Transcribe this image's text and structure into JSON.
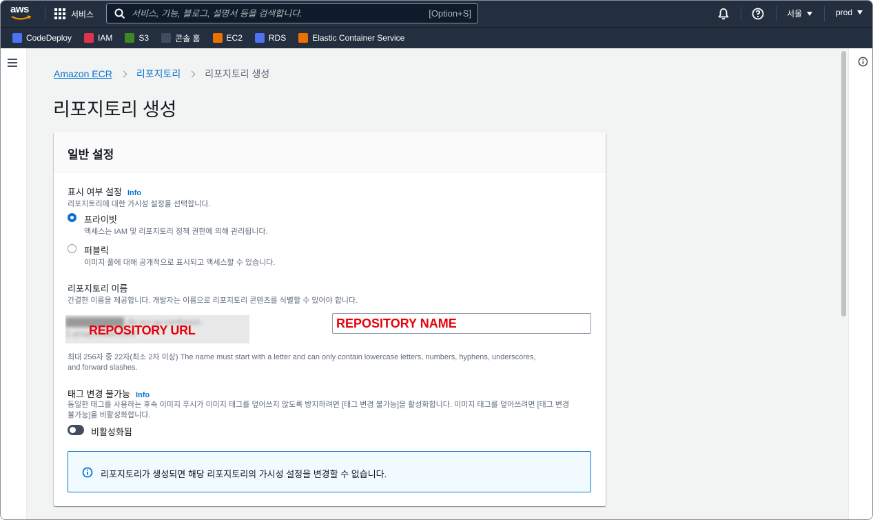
{
  "topnav": {
    "logo_text": "aws",
    "services_label": "서비스",
    "search_placeholder": "서비스, 기능, 블로그, 설명서 등을 검색합니다.",
    "search_shortcut": "[Option+S]",
    "region_label": "서울",
    "account_label": "prod"
  },
  "favorites": [
    {
      "label": "CodeDeploy",
      "color": "#4d72f3"
    },
    {
      "label": "IAM",
      "color": "#dd344c"
    },
    {
      "label": "S3",
      "color": "#3f8624"
    },
    {
      "label": "콘솔 홈",
      "color": "#414d5c"
    },
    {
      "label": "EC2",
      "color": "#ed7100"
    },
    {
      "label": "RDS",
      "color": "#4d72f3"
    },
    {
      "label": "Elastic Container Service",
      "color": "#ed7100"
    }
  ],
  "breadcrumb": {
    "root": "Amazon ECR",
    "parent": "리포지토리",
    "current": "리포지토리 생성"
  },
  "page_title": "리포지토리 생성",
  "general_settings": {
    "title": "일반 설정",
    "visibility": {
      "label": "표시 여부 설정",
      "info": "Info",
      "description": "리포지토리에 대한 가시성 설정을 선택합니다.",
      "options": [
        {
          "label": "프라이빗",
          "description": "액세스는 IAM 및 리포지토리 정책 권한에 의해 관리됩니다.",
          "selected": true
        },
        {
          "label": "퍼블릭",
          "description": "이미지 풀에 대해 공개적으로 표시되고 액세스할 수 있습니다.",
          "selected": false
        }
      ]
    },
    "repo_name": {
      "label": "리포지토리 이름",
      "description": "간결한 이름을 제공합니다. 개발자는 이름으로 리포지토리 콘텐츠를 식별할 수 있어야 합니다.",
      "url_prefix_blurred": "██████████.dkr.ecr.ap-northeast-2.amazonaws.com/",
      "url_annotation": "REPOSITORY URL",
      "name_annotation": "REPOSITORY NAME",
      "constraint_line1": "최대 256자 중 22자(최소 2자 이상) The name must start with a letter and can only contain lowercase letters, numbers, hyphens, underscores,",
      "constraint_line2": "and forward slashes."
    },
    "tag_immutability": {
      "label": "태그 변경 불가능",
      "info": "Info",
      "description_line1": "동일한 태그를 사용하는 후속 이미지 푸시가 이미지 태그를 덮어쓰지 않도록 방지하려면 [태그 변경 불가능]을 활성화합니다. 이미지 태그를 덮어쓰려면 [태그 변경",
      "description_line2": "불가능]을 비활성화합니다.",
      "toggle_label": "비활성화됨",
      "enabled": false
    },
    "alert_text": "리포지토리가 생성되면 해당 리포지토리의 가시성 설정을 변경할 수 없습니다."
  }
}
